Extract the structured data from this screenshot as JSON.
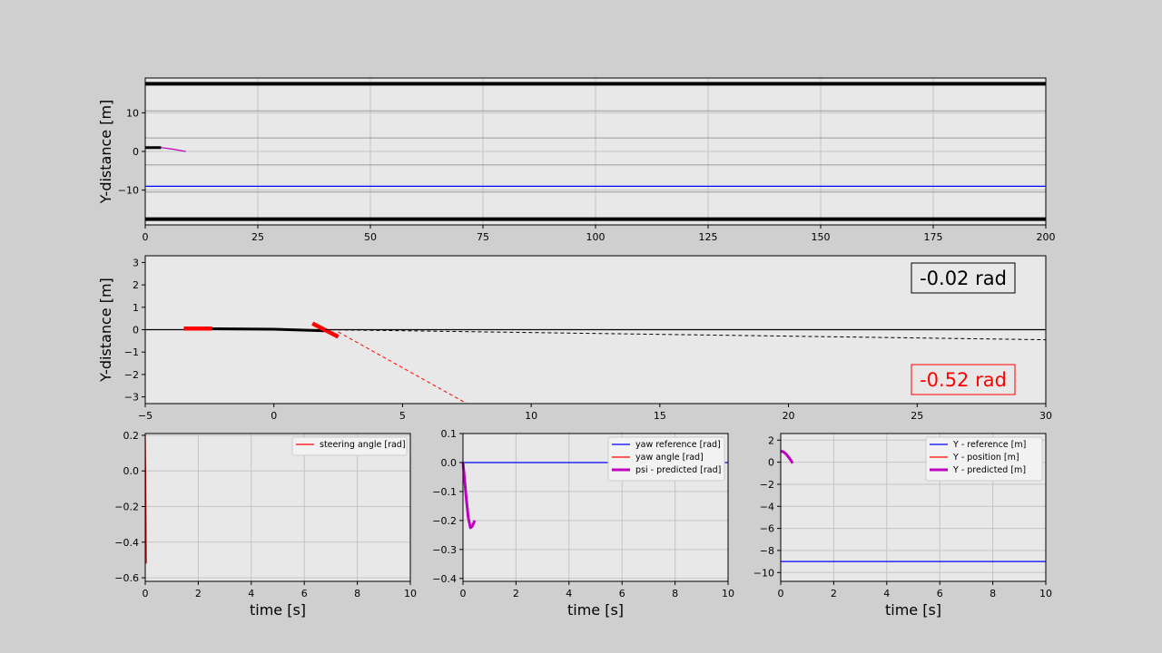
{
  "chart_data": [
    {
      "type": "line",
      "id": "road_top",
      "ylabel": "Y-distance [m]",
      "xlabel": "",
      "xlim": [
        0,
        200
      ],
      "ylim": [
        -19,
        19
      ],
      "xticks": [
        0,
        25,
        50,
        75,
        100,
        125,
        150,
        175,
        200
      ],
      "yticks": [
        -10,
        0,
        10
      ],
      "grid": true,
      "series": [
        {
          "role": "road-edge-top",
          "color": "#000000",
          "x": [
            0,
            200
          ],
          "y": [
            17.5,
            17.5
          ]
        },
        {
          "role": "road-edge-bottom",
          "color": "#000000",
          "x": [
            0,
            200
          ],
          "y": [
            -17.5,
            -17.5
          ]
        },
        {
          "role": "lane-dashes",
          "color": "#9a9a9a",
          "y_lines": [
            10.5,
            3.5,
            -3.5,
            -10.5
          ]
        },
        {
          "role": "reference",
          "color": "#0000ff",
          "x": [
            0,
            200
          ],
          "y": [
            -9,
            -9
          ]
        },
        {
          "role": "vehicle",
          "color": "#000000",
          "x": [
            0,
            3.5
          ],
          "y": [
            1,
            1
          ]
        },
        {
          "role": "predicted",
          "color": "#c000c0",
          "x": [
            3.5,
            6,
            9
          ],
          "y": [
            1,
            0.6,
            0
          ]
        }
      ]
    },
    {
      "type": "line",
      "id": "road_zoom",
      "ylabel": "Y-distance [m]",
      "xlabel": "",
      "xlim": [
        -5,
        30
      ],
      "ylim": [
        -3.3,
        3.3
      ],
      "xticks": [
        -5,
        0,
        5,
        10,
        15,
        20,
        25,
        30
      ],
      "yticks": [
        -3,
        -2,
        -1,
        0,
        1,
        2,
        3
      ],
      "grid": false,
      "annotations": [
        {
          "text": "-0.02 rad",
          "color": "#000000"
        },
        {
          "text": "-0.52 rad",
          "color": "#ff0000"
        }
      ],
      "series": [
        {
          "role": "axis-zero",
          "color": "#000000",
          "x": [
            -5,
            30
          ],
          "y": [
            0,
            0
          ]
        },
        {
          "role": "trajectory",
          "color": "#000000",
          "x": [
            -3.5,
            0,
            2
          ],
          "y": [
            0.05,
            0.02,
            -0.05
          ]
        },
        {
          "role": "vehicle-rear",
          "color": "#ff0000",
          "x": [
            -3.5,
            -2.4
          ],
          "y": [
            0.05,
            0.05
          ]
        },
        {
          "role": "vehicle-front",
          "color": "#ff0000",
          "x": [
            1.5,
            2.5
          ],
          "y": [
            0.28,
            -0.32
          ]
        },
        {
          "role": "yaw-dashed",
          "color": "#000000",
          "x": [
            2,
            30
          ],
          "y": [
            0,
            -0.45
          ]
        },
        {
          "role": "steer-dashed",
          "color": "#ff0000",
          "x": [
            2.5,
            7.5
          ],
          "y": [
            -0.1,
            -3.3
          ]
        }
      ]
    },
    {
      "type": "line",
      "id": "steering",
      "xlabel": "time [s]",
      "ylabel": "",
      "xlim": [
        0,
        10
      ],
      "ylim": [
        -0.62,
        0.21
      ],
      "xticks": [
        0,
        2,
        4,
        6,
        8,
        10
      ],
      "yticks": [
        -0.6,
        -0.4,
        -0.2,
        0.0,
        0.2
      ],
      "ytick_labels": [
        "−0.6",
        "−0.4",
        "−0.2",
        "0.0",
        "0.2"
      ],
      "grid": true,
      "series": [
        {
          "name": "steering angle [rad]",
          "color": "#ff0000",
          "x": [
            0,
            0.02,
            0.04
          ],
          "y": [
            0.2,
            -0.1,
            -0.52
          ]
        }
      ]
    },
    {
      "type": "line",
      "id": "yaw",
      "xlabel": "time [s]",
      "ylabel": "",
      "xlim": [
        0,
        10
      ],
      "ylim": [
        -0.41,
        0.1
      ],
      "xticks": [
        0,
        2,
        4,
        6,
        8,
        10
      ],
      "yticks": [
        -0.4,
        -0.3,
        -0.2,
        -0.1,
        0.0,
        0.1
      ],
      "ytick_labels": [
        "−0.4",
        "−0.3",
        "−0.2",
        "−0.1",
        "0.0",
        "0.1"
      ],
      "grid": true,
      "series": [
        {
          "name": "yaw reference [rad]",
          "color": "#0000ff",
          "x": [
            0,
            10
          ],
          "y": [
            0,
            0
          ]
        },
        {
          "name": "yaw angle [rad]",
          "color": "#ff0000",
          "x": [
            0
          ],
          "y": [
            0
          ]
        },
        {
          "name": "psi - predicted [rad]",
          "color": "#c000c0",
          "x": [
            0,
            0.05,
            0.12,
            0.2,
            0.28,
            0.35,
            0.42,
            0.45
          ],
          "y": [
            0,
            -0.05,
            -0.12,
            -0.19,
            -0.225,
            -0.22,
            -0.205,
            -0.2
          ]
        }
      ]
    },
    {
      "type": "line",
      "id": "ypos",
      "xlabel": "time [s]",
      "ylabel": "",
      "xlim": [
        0,
        10
      ],
      "ylim": [
        -10.8,
        2.6
      ],
      "xticks": [
        0,
        2,
        4,
        6,
        8,
        10
      ],
      "yticks": [
        -10,
        -8,
        -6,
        -4,
        -2,
        0,
        2
      ],
      "ytick_labels": [
        "−10",
        "−8",
        "−6",
        "−4",
        "−2",
        "0",
        "2"
      ],
      "grid": true,
      "series": [
        {
          "name": "Y - reference [m]",
          "color": "#0000ff",
          "x": [
            0,
            10
          ],
          "y": [
            -9,
            -9
          ]
        },
        {
          "name": "Y - position [m]",
          "color": "#ff0000",
          "x": [
            0
          ],
          "y": [
            1
          ]
        },
        {
          "name": "Y - predicted [m]",
          "color": "#c000c0",
          "x": [
            0,
            0.1,
            0.2,
            0.3,
            0.4,
            0.45
          ],
          "y": [
            1,
            0.95,
            0.75,
            0.45,
            0.1,
            -0.1
          ]
        }
      ]
    }
  ]
}
